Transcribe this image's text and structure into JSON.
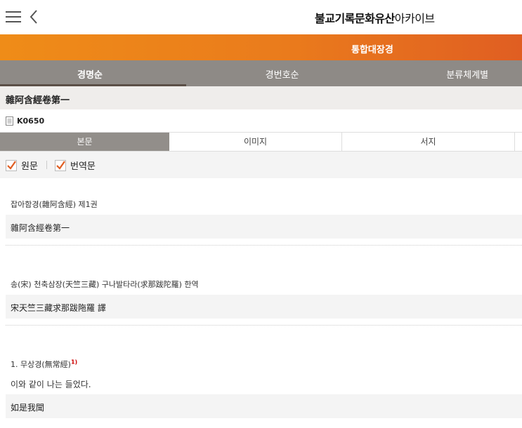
{
  "header": {
    "site_title_bold": "불교기록문화유산",
    "site_title_light": "아카이브",
    "menu_icon": "hamburger-menu-icon",
    "back_icon": "chevron-left-icon"
  },
  "banner": {
    "label": "통합대장경",
    "gradient": [
      "#ef8c18",
      "#e05e22"
    ]
  },
  "tabs": [
    {
      "label": "경명순",
      "active": true
    },
    {
      "label": "경번호순",
      "active": false
    },
    {
      "label": "분류체계별",
      "active": false
    }
  ],
  "document": {
    "title": "雜阿含經卷第一",
    "code": "K0650",
    "code_icon": "document-icon"
  },
  "subtabs": [
    {
      "label": "본문",
      "active": true
    },
    {
      "label": "이미지",
      "active": false
    },
    {
      "label": "서지",
      "active": false
    }
  ],
  "filters": [
    {
      "label": "원문",
      "checked": true
    },
    {
      "label": "번역문",
      "checked": true
    }
  ],
  "accent_color": "#e05e22",
  "content": {
    "block1": {
      "translation": "잡아함경(雜阿含經) 제1권",
      "original": "雜阿含經卷第一"
    },
    "block2": {
      "translation": "송(宋) 천축삼장(天竺三藏) 구나발타라(求那跋陀羅) 한역",
      "original": "宋天竺三藏求那跋陁羅 譯"
    },
    "block3": {
      "heading": "1. 무상경(無常經)",
      "footnote": "1)",
      "translation": "이와 같이 나는 들었다.",
      "original": "如是我聞"
    }
  }
}
